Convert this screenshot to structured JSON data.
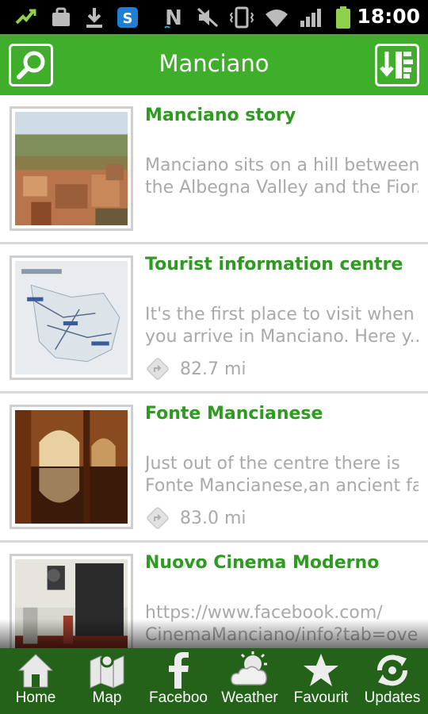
{
  "status_bar": {
    "time": "18:00",
    "icons": [
      "wifi-toggle-icon",
      "bag-icon",
      "download-icon",
      "skype-icon",
      "nfc-icon",
      "mute-icon",
      "vibrate-icon",
      "wifi-icon",
      "signal-icon",
      "battery-icon"
    ]
  },
  "header": {
    "title": "Manciano",
    "left_icon": "search-icon",
    "right_icon": "sort-icon",
    "color": "#3fae2a"
  },
  "list": [
    {
      "title": "Manciano story",
      "desc_line1": "Manciano sits on a hill between",
      "desc_line2": "the Albegna Valley and the Fior...",
      "distance": ""
    },
    {
      "title": "Tourist information centre",
      "desc_line1": "It's the first place to visit when",
      "desc_line2": "you arrive in Manciano.  Here y...",
      "distance": "82.7 mi"
    },
    {
      "title": "Fonte Mancianese",
      "desc_line1": "Just out of the centre there is",
      "desc_line2": "Fonte Mancianese,an ancient fa...",
      "distance": "83.0 mi"
    },
    {
      "title": "Nuovo Cinema Moderno",
      "desc_line1": "https://www.facebook.com/",
      "desc_line2": "CinemaManciano/info?tab=ove...",
      "distance": ""
    }
  ],
  "bottom_nav": [
    {
      "label": "Home",
      "icon": "home-icon"
    },
    {
      "label": "Map",
      "icon": "map-icon"
    },
    {
      "label": "Faceboo",
      "icon": "facebook-icon"
    },
    {
      "label": "Weather",
      "icon": "weather-icon"
    },
    {
      "label": "Favourit",
      "icon": "star-icon"
    },
    {
      "label": "Updates",
      "icon": "refresh-icon"
    }
  ],
  "colors": {
    "accent": "#3fae2a",
    "title_green": "#2d9a20",
    "nav_bg": "#24621a",
    "desc_gray": "#a9a9a9"
  }
}
